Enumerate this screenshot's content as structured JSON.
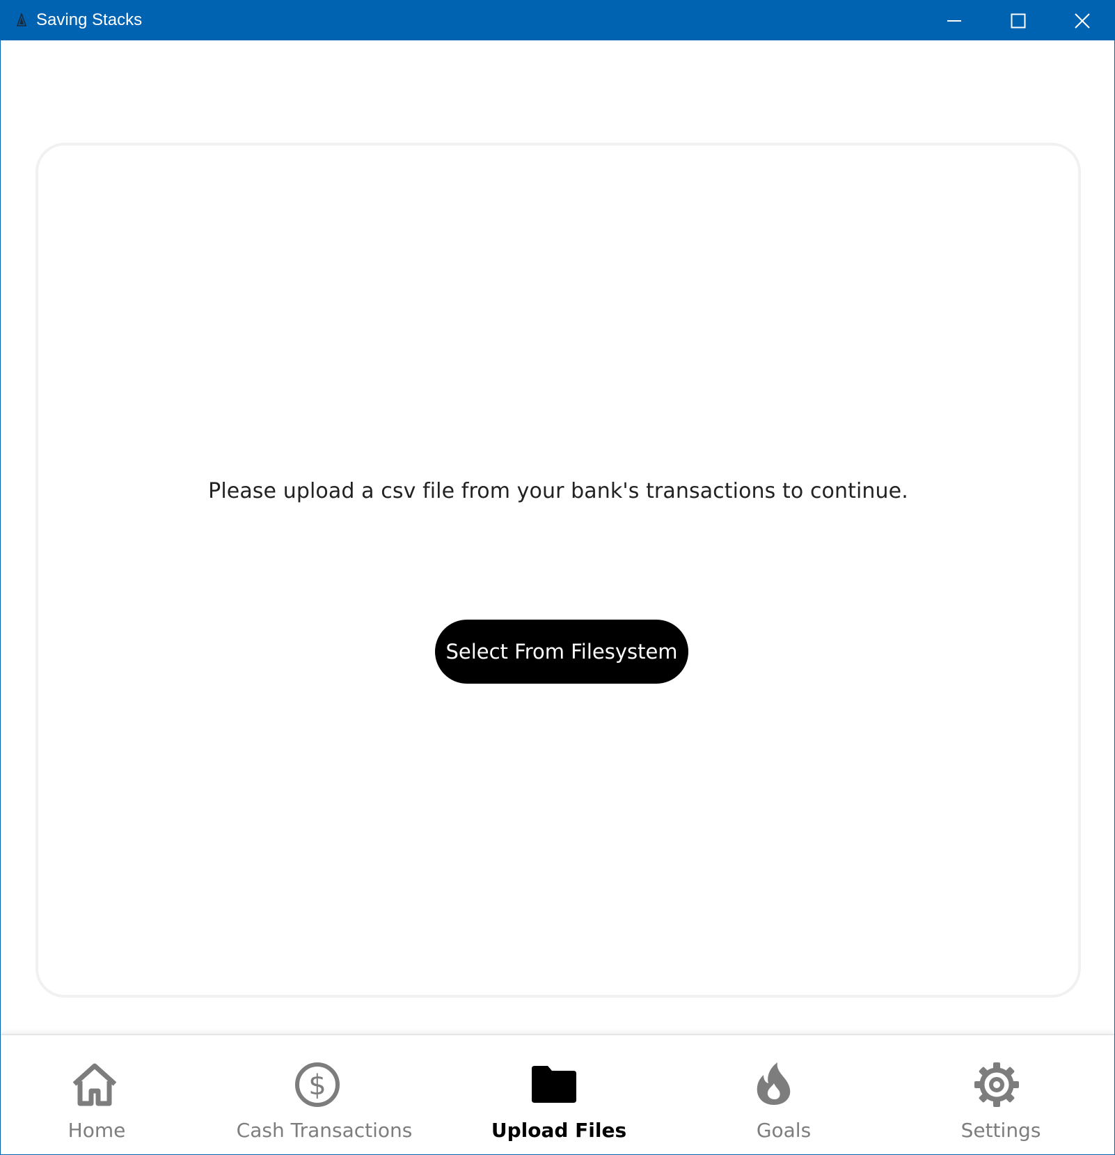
{
  "window": {
    "title": "Saving Stacks",
    "controls": {
      "minimize": "minimize",
      "maximize": "maximize",
      "close": "close"
    },
    "accent_color": "#0063b1"
  },
  "main": {
    "message": "Please upload a csv file from your bank's transactions to continue.",
    "select_button_label": "Select From Filesystem"
  },
  "nav": {
    "items": [
      {
        "label": "Home",
        "icon": "home-icon",
        "active": false
      },
      {
        "label": "Cash Transactions",
        "icon": "dollar-circle-icon",
        "active": false
      },
      {
        "label": "Upload Files",
        "icon": "folder-icon",
        "active": true
      },
      {
        "label": "Goals",
        "icon": "flame-icon",
        "active": false
      },
      {
        "label": "Settings",
        "icon": "gear-icon",
        "active": false
      }
    ],
    "active_color": "#000000",
    "inactive_color": "#7d7d7d"
  }
}
